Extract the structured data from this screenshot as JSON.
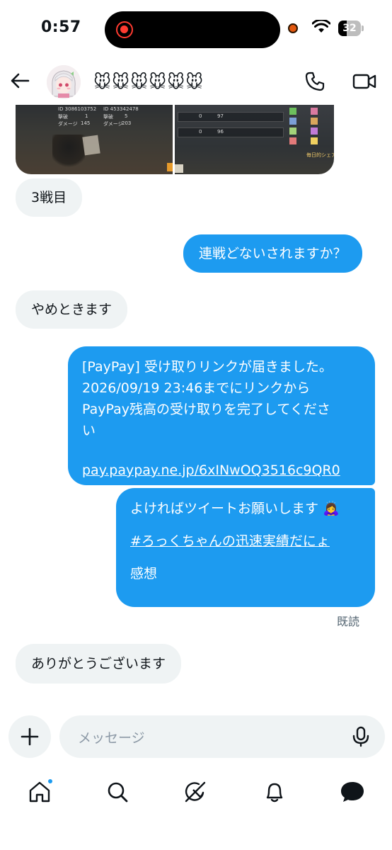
{
  "status_bar": {
    "time": "0:57",
    "battery": "32",
    "accent": "#ff3b30"
  },
  "header": {
    "contact_name": "🐭🐭🐭🐭🐭🐭",
    "back_icon": "arrow-left-icon",
    "call_icon": "phone-icon",
    "video_icon": "video-icon"
  },
  "attachment": {
    "left": {
      "id_a": "ID 3086103752",
      "id_b": "ID 453342478",
      "kills_label": "撃破",
      "kills_a": "1",
      "kills_b": "5",
      "damage_label": "ダメージ",
      "damage_a": "145",
      "damage_b": "203"
    },
    "right": {
      "row1_a": "0",
      "row1_b": "97",
      "row2_a": "0",
      "row2_b": "96",
      "footer": "毎日的シェア"
    }
  },
  "messages": [
    {
      "direction": "incoming",
      "lines": [
        "3戦目"
      ]
    },
    {
      "direction": "outgoing",
      "lines": [
        "連戦どないされますか？"
      ]
    },
    {
      "direction": "incoming",
      "lines": [
        "やめときます"
      ]
    },
    {
      "direction": "outgoing",
      "lines": [
        "[PayPay] 受け取りリンクが届きました。",
        "2026/09/19 23:46までにリンクから",
        "PayPay残高の受け取りを完了してくださ",
        "い"
      ],
      "link": "pay.paypay.ne.jp/6xINwOQ3516c9QR0"
    },
    {
      "direction": "outgoing",
      "lines": [
        "よければツイートお願いします 🙇‍♀️"
      ],
      "hashtag": "#ろっくちゃんの迅速実績だにょ",
      "last_line": "感想"
    },
    {
      "direction": "incoming",
      "lines": [
        "ありがとうございます"
      ]
    }
  ],
  "read_receipt": "既読",
  "composer": {
    "placeholder": "メッセージ",
    "add_icon": "plus-icon",
    "mic_icon": "microphone-icon"
  },
  "tabs": [
    {
      "name": "home",
      "icon": "home-icon",
      "has_badge": true
    },
    {
      "name": "search",
      "icon": "search-icon"
    },
    {
      "name": "grok",
      "icon": "grok-icon"
    },
    {
      "name": "notifications",
      "icon": "bell-icon"
    },
    {
      "name": "messages",
      "icon": "chat-bubble-icon",
      "active": true
    }
  ],
  "colors": {
    "outgoing_bubble": "#1d9bf0",
    "incoming_bubble": "#eff3f4",
    "text": "#0f1419",
    "muted": "#536471"
  }
}
